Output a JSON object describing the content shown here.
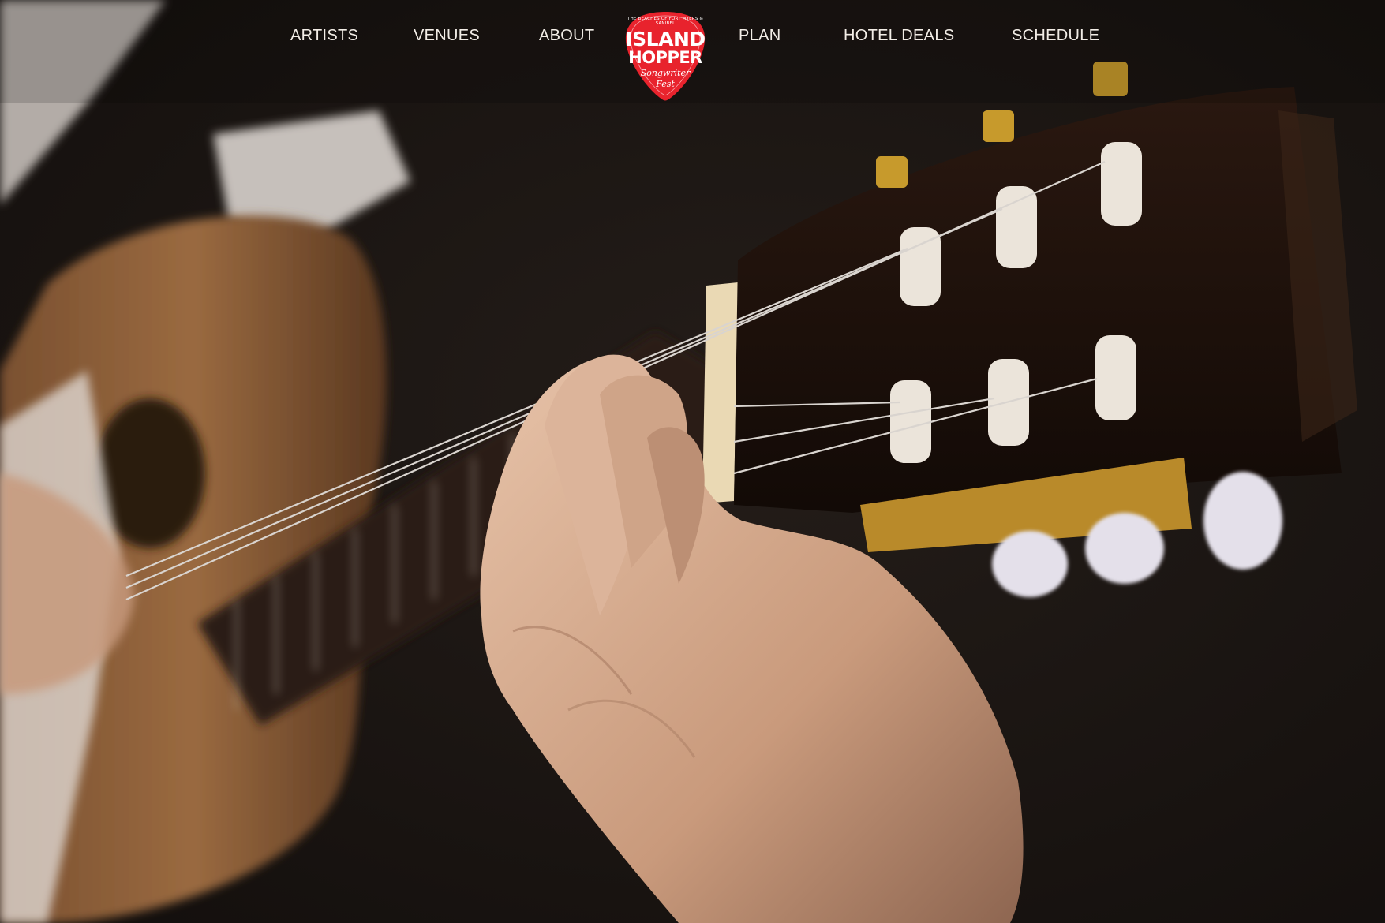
{
  "nav": {
    "items": [
      {
        "label": "ARTISTS"
      },
      {
        "label": "VENUES"
      },
      {
        "label": "ABOUT"
      },
      {
        "label": "PLAN"
      },
      {
        "label": "HOTEL DEALS"
      },
      {
        "label": "SCHEDULE"
      }
    ]
  },
  "logo": {
    "arc_text": "THE BEACHES OF FORT MYERS & SANIBEL",
    "line1": "ISLAND",
    "line2": "HOPPER",
    "line3": "Songwriter",
    "line4": "Fest",
    "icon": "guitar-pick-icon"
  },
  "hero": {
    "image": "guitar-closeup-photo"
  },
  "colors": {
    "logo_red": "#e8232d",
    "nav_text": "#f2ede6",
    "background": "#1a1512"
  }
}
